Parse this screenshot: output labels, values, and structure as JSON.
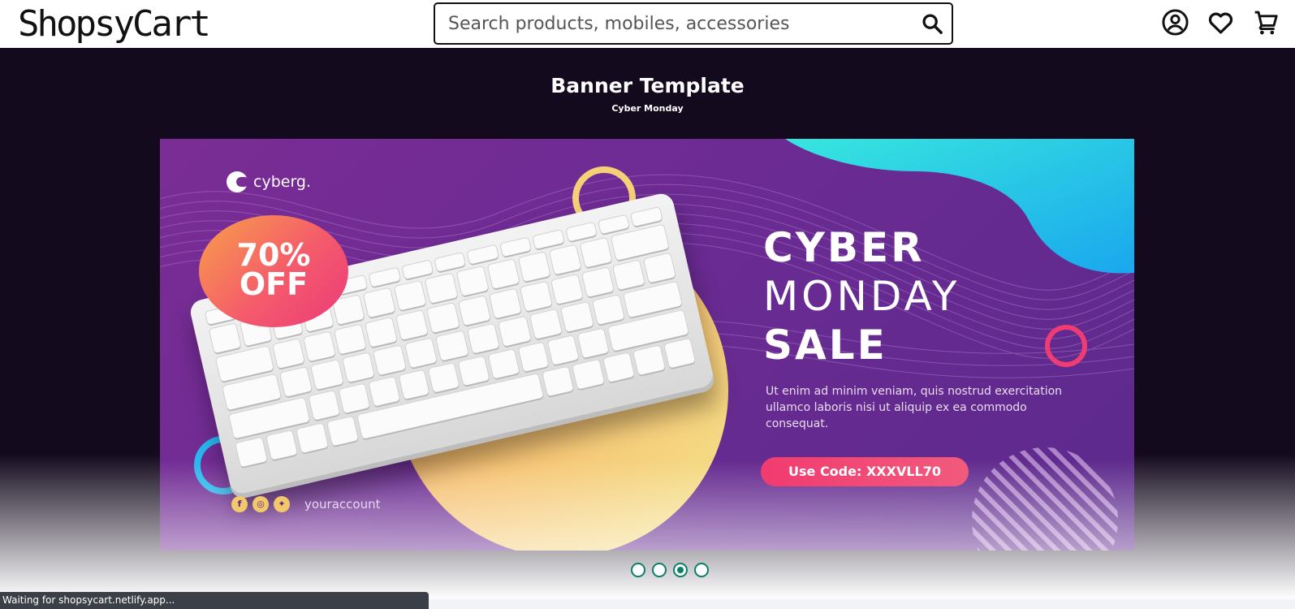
{
  "header": {
    "logo": "ShopsyCart",
    "search_placeholder": "Search products, mobiles, accessories",
    "icons": [
      "account-icon",
      "wishlist-heart-icon",
      "cart-icon"
    ]
  },
  "hero": {
    "title": "Banner Template",
    "subtitle": "Cyber Monday"
  },
  "banner": {
    "brand": "cyberg.",
    "discount_line1": "70%",
    "discount_line2": "OFF",
    "headline_line1": "CYBER",
    "headline_line2": "MONDAY",
    "headline_line3": "SALE",
    "description": "Ut enim ad minim veniam, quis nostrud exercitation ullamco laboris nisi ut aliquip ex ea commodo consequat.",
    "code_button": "Use Code: XXXVLL70",
    "social_icons": [
      "facebook-icon",
      "instagram-icon",
      "twitter-icon"
    ],
    "account": "youraccount"
  },
  "carousel": {
    "slide_count": 4,
    "active_slide": 3
  },
  "statusbar": {
    "text": "Waiting for shopsycart.netlify.app..."
  },
  "colors": {
    "accent": "#0b7f6a",
    "banner_purple": "#7a2d95",
    "pink": "#f13b70",
    "hero_bg": "#130a1d"
  }
}
